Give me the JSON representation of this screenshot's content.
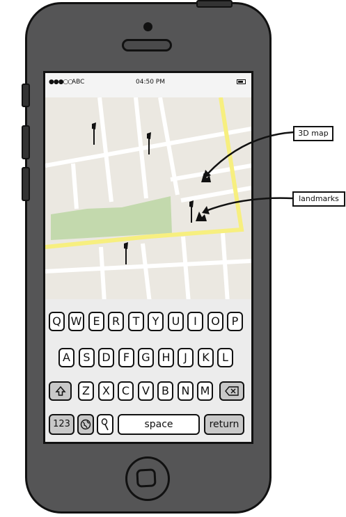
{
  "status_bar": {
    "signal": "●●●○○",
    "carrier": "ABC",
    "time": "04:50 PM"
  },
  "callouts": {
    "map_3d": "3D map",
    "landmarks": "landmarks"
  },
  "keyboard": {
    "row1": [
      "Q",
      "W",
      "E",
      "R",
      "T",
      "Y",
      "U",
      "I",
      "O",
      "P"
    ],
    "row2": [
      "A",
      "S",
      "D",
      "F",
      "G",
      "H",
      "J",
      "K",
      "L"
    ],
    "row3": [
      "Z",
      "X",
      "C",
      "V",
      "B",
      "N",
      "M"
    ],
    "numbers_key": "123",
    "space_key": "space",
    "return_key": "return"
  },
  "icons": {
    "shift": "shift-arrow-icon",
    "backspace": "backspace-icon",
    "globe": "globe-icon",
    "mic": "microphone-icon",
    "pin": "map-pin-icon",
    "landmark": "landmark-icon"
  },
  "colors": {
    "phone_body": "#555556",
    "map_bg": "#ebe8e1",
    "map_road": "#ffffff",
    "map_highway": "#f7ef7f",
    "map_park": "#c3d9ad"
  }
}
